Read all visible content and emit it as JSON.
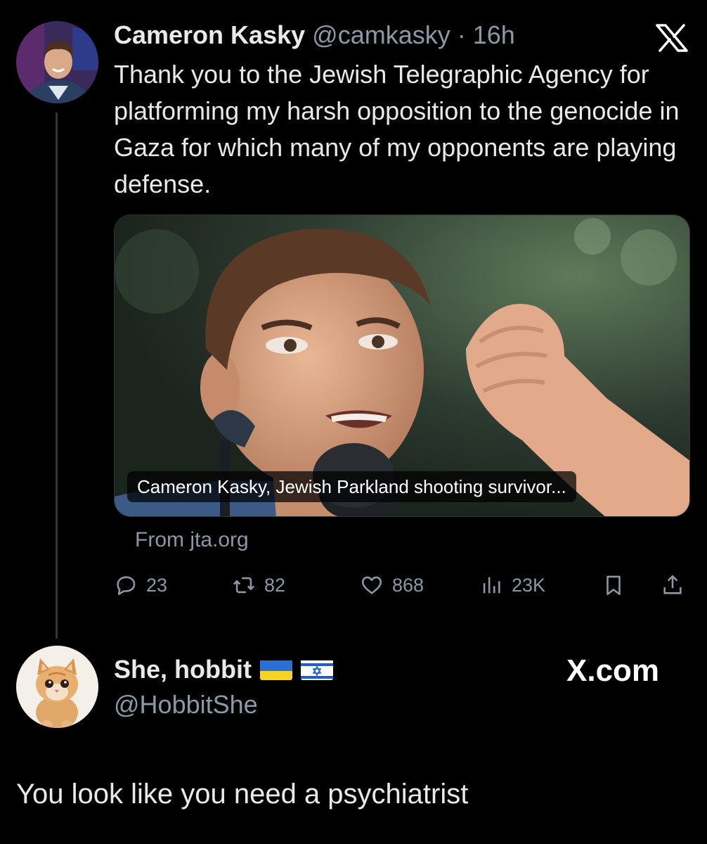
{
  "tweet": {
    "author_name": "Cameron Kasky",
    "author_handle": "@camkasky",
    "separator": "·",
    "time": "16h",
    "text": "Thank you to the Jewish Telegraphic Agency for platforming my harsh opposition to the genocide in Gaza for which many of my opponents are playing defense.",
    "card": {
      "caption": "Cameron Kasky, Jewish Parkland shooting survivor...",
      "source": "From jta.org"
    },
    "actions": {
      "replies": "23",
      "retweets": "82",
      "likes": "868",
      "views": "23K"
    },
    "icons": [
      "x-logo-icon",
      "reply-icon",
      "retweet-icon",
      "heart-icon",
      "views-icon",
      "bookmark-icon",
      "share-icon"
    ]
  },
  "reply": {
    "author_name": "She, hobbit",
    "flags": [
      "ukraine-flag-icon",
      "israel-flag-icon"
    ],
    "author_handle": "@HobbitShe",
    "text": "You look like you need a psychiatrist"
  },
  "watermark": "X.com",
  "colors": {
    "background": "#000000",
    "text_primary": "#e7e9ea",
    "text_secondary": "#8b98a5",
    "thread_line": "#333639"
  }
}
